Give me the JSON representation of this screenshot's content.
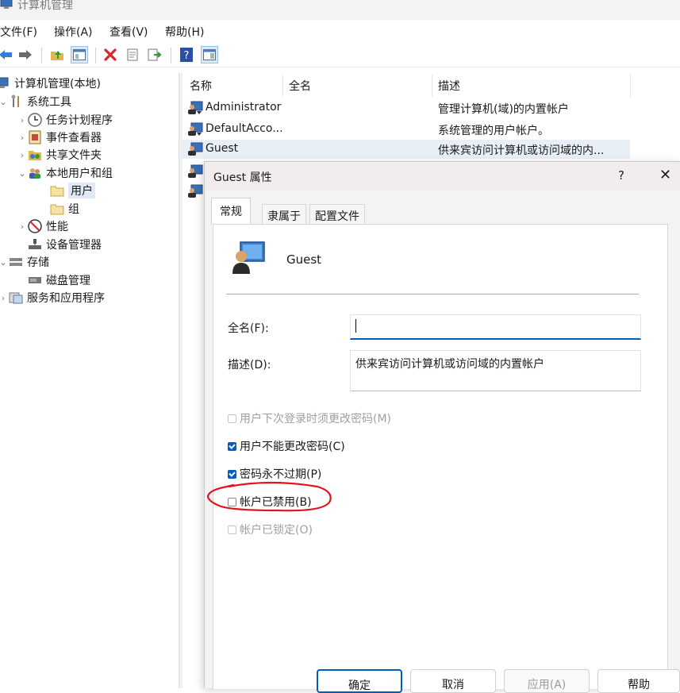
{
  "window": {
    "title": "计算机管理"
  },
  "menu": [
    "文件(F)",
    "操作(A)",
    "查看(V)",
    "帮助(H)"
  ],
  "toolbar_icons": [
    "back-arrow-icon",
    "forward-arrow-icon",
    "up-folder-icon",
    "show-hide-tree-icon",
    "delete-icon",
    "properties-icon",
    "export-icon",
    "help-icon",
    "action-pane-icon"
  ],
  "tree": [
    {
      "label": "计算机管理(本地)",
      "icon": "computer-management-icon"
    },
    {
      "label": "系统工具",
      "icon": "tools-icon"
    },
    {
      "label": "任务计划程序",
      "icon": "clock-icon"
    },
    {
      "label": "事件查看器",
      "icon": "event-viewer-icon"
    },
    {
      "label": "共享文件夹",
      "icon": "shared-folder-icon"
    },
    {
      "label": "本地用户和组",
      "icon": "users-group-icon"
    },
    {
      "label": "用户",
      "icon": "folder-icon"
    },
    {
      "label": "组",
      "icon": "folder-icon"
    },
    {
      "label": "性能",
      "icon": "performance-icon"
    },
    {
      "label": "设备管理器",
      "icon": "device-manager-icon"
    },
    {
      "label": "存储",
      "icon": "storage-icon"
    },
    {
      "label": "磁盘管理",
      "icon": "disk-icon"
    },
    {
      "label": "服务和应用程序",
      "icon": "services-icon"
    }
  ],
  "list": {
    "columns": [
      "名称",
      "全名",
      "描述"
    ],
    "rows": [
      {
        "name": "Administrator",
        "fullname": "",
        "desc": "管理计算机(域)的内置帐户"
      },
      {
        "name": "DefaultAcco...",
        "fullname": "",
        "desc": "系统管理的用户帐户。"
      },
      {
        "name": "Guest",
        "fullname": "",
        "desc": "供来宾访问计算机或访问域的内..."
      }
    ]
  },
  "dialog": {
    "title": "Guest 属性",
    "help": "?",
    "close": "✕",
    "tabs": [
      "常规",
      "隶属于",
      "配置文件"
    ],
    "username": "Guest",
    "fullname_label": "全名(F):",
    "fullname_value": "",
    "desc_label": "描述(D):",
    "desc_value": "供来宾访问计算机或访问域的内置帐户",
    "checkboxes": [
      {
        "label": "用户下次登录时须更改密码(M)",
        "checked": false,
        "disabled": true
      },
      {
        "label": "用户不能更改密码(C)",
        "checked": true,
        "disabled": false
      },
      {
        "label": "密码永不过期(P)",
        "checked": true,
        "disabled": false
      },
      {
        "label": "帐户已禁用(B)",
        "checked": false,
        "disabled": false
      },
      {
        "label": "帐户已锁定(O)",
        "checked": false,
        "disabled": true
      }
    ],
    "buttons": [
      "确定",
      "取消",
      "应用(A)",
      "帮助"
    ]
  },
  "colors": {
    "accent": "#005fb8",
    "annotation": "#e0141c",
    "selection": "#dfe8f3"
  }
}
